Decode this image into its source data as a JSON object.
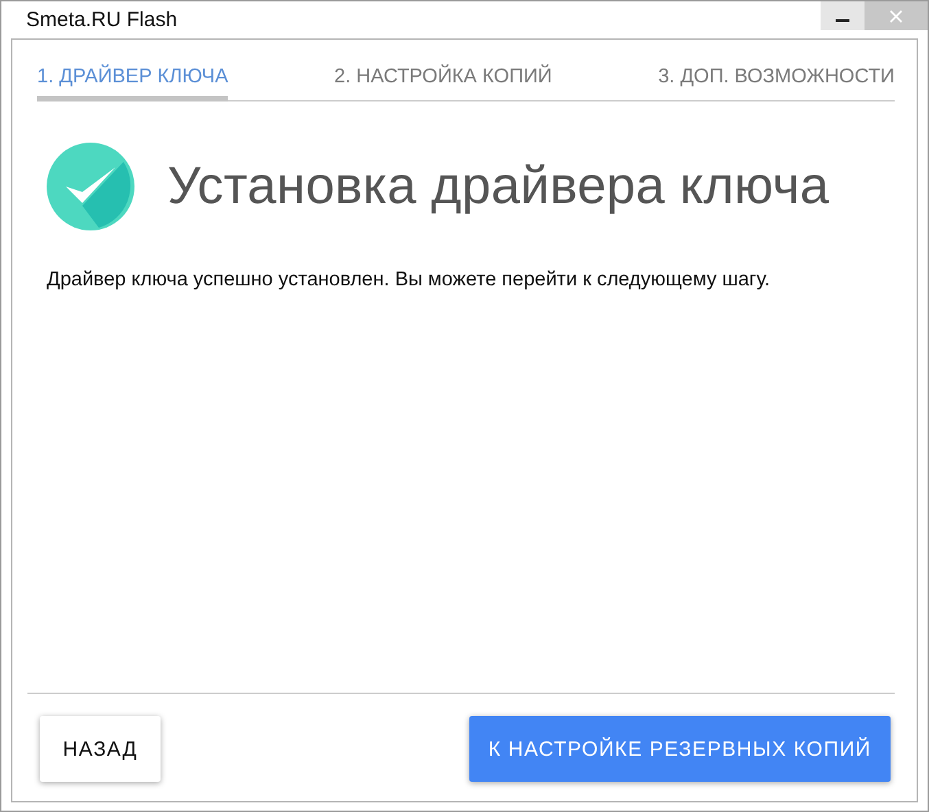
{
  "window": {
    "title": "Smeta.RU Flash"
  },
  "steps": [
    {
      "label": "1. ДРАЙВЕР КЛЮЧА",
      "selected": true
    },
    {
      "label": "2. НАСТРОЙКА КОПИЙ",
      "selected": false
    },
    {
      "label": "3. ДОП. ВОЗМОЖНОСТИ",
      "selected": false
    }
  ],
  "heading": "Установка драйвера ключа",
  "message": "Драйвер ключа успешно установлен. Вы можете перейти к следующему шагу.",
  "buttons": [
    {
      "label": "НАЗАД",
      "kind": "secondary"
    },
    {
      "label": "К НАСТРОЙКЕ РЕЗЕРВНЫХ КОПИЙ",
      "kind": "primary"
    }
  ]
}
